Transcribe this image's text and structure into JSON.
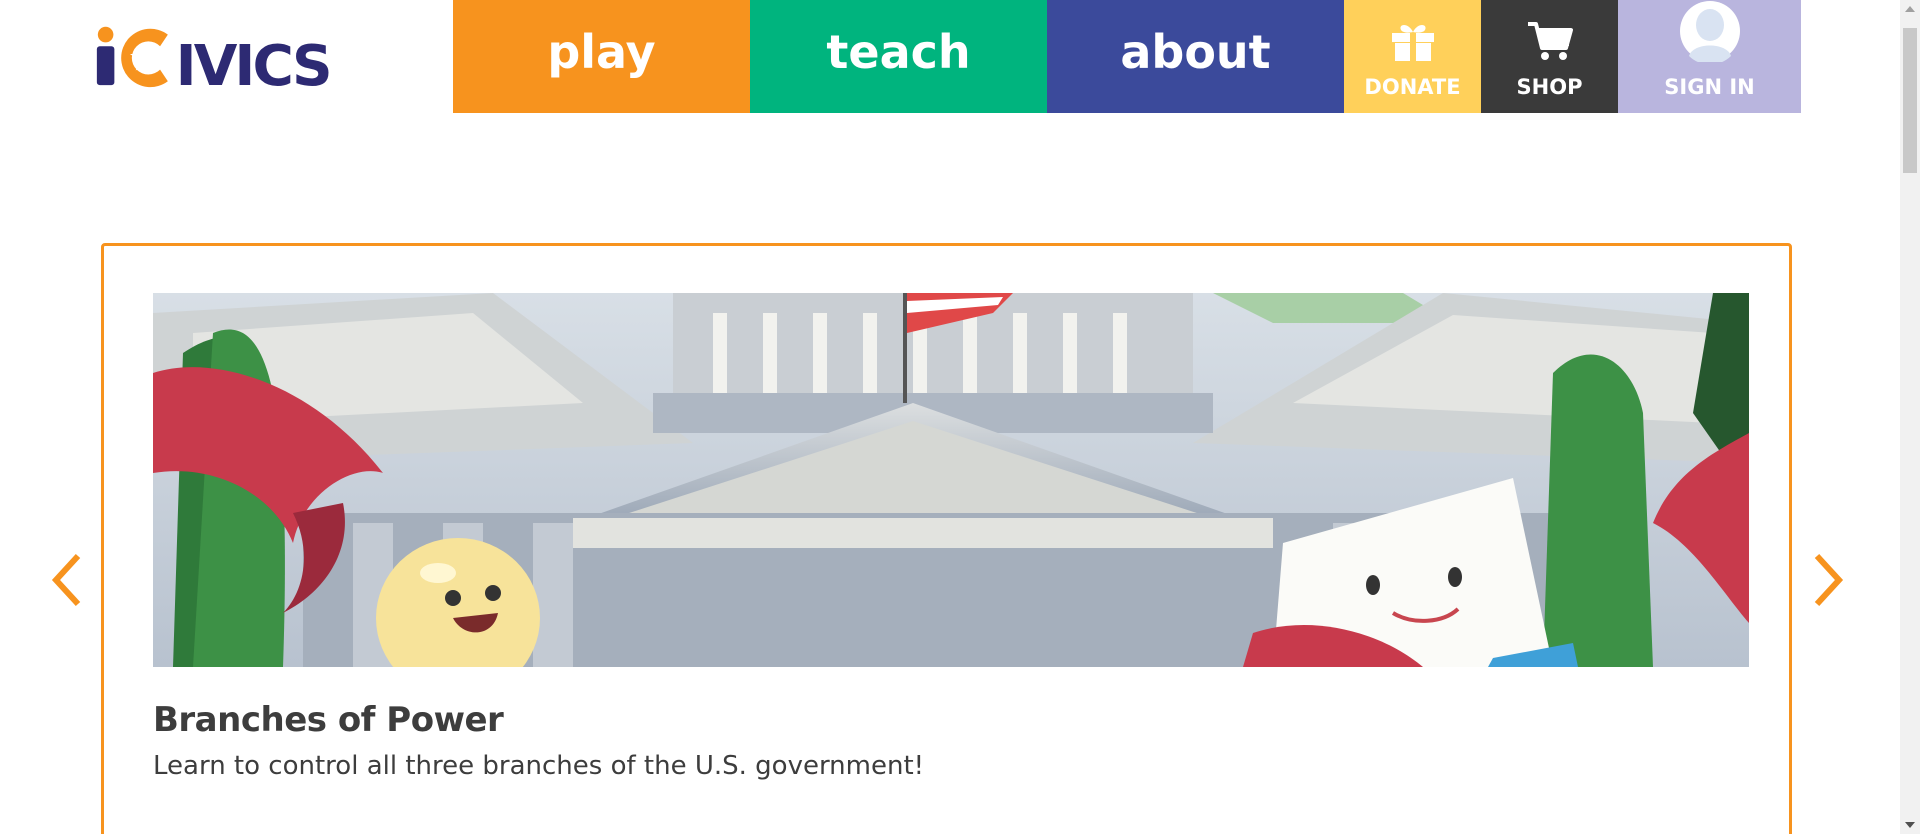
{
  "logo": {
    "text": "iCivics"
  },
  "nav": {
    "play": "play",
    "teach": "teach",
    "about": "about",
    "donate": "DONATE",
    "shop": "SHOP",
    "signin": "SIGN IN"
  },
  "carousel": {
    "title": "Branches of Power",
    "description": "Learn to control all three branches of the U.S. government!"
  },
  "colors": {
    "play": "#f7931e",
    "teach": "#00b47e",
    "about": "#3b4a9b",
    "donate": "#ffd05a",
    "shop": "#3a3a3a",
    "signin": "#b9b5de",
    "accent": "#f7931e",
    "logo": "#2d2a73"
  }
}
